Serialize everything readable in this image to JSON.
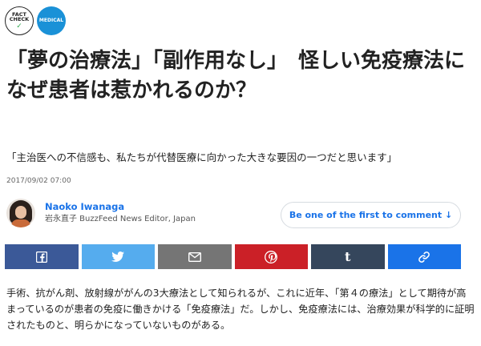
{
  "badges": {
    "fact_check_line1": "FACT",
    "fact_check_line2": "CHECK",
    "medical": "MEDICAL"
  },
  "article": {
    "title": "「夢の治療法」「副作用なし」　怪しい免疫療法になぜ患者は惹かれるのか？",
    "subtitle": "「主治医への不信感も、私たちが代替医療に向かった大きな要因の一つだと思います」",
    "date": "2017/09/02 07:00",
    "body": "手術、抗がん剤、放射線ががんの3大療法として知られるが、これに近年、「第４の療法」として期待が高まっているのが患者の免疫に働きかける「免疫療法」だ。しかし、免疫療法には、治療効果が科学的に証明されたものと、明らかになっていないものがある。"
  },
  "author": {
    "name": "Naoko Iwanaga",
    "role": "岩永直子 BuzzFeed News Editor, Japan"
  },
  "comment": {
    "label": "Be one of the first to comment ↓"
  },
  "share": [
    {
      "name": "facebook",
      "icon": "facebook-icon",
      "color": "#3b5998"
    },
    {
      "name": "twitter",
      "icon": "twitter-icon",
      "color": "#55acee"
    },
    {
      "name": "email",
      "icon": "mail-icon",
      "color": "#757575"
    },
    {
      "name": "pinterest",
      "icon": "pinterest-icon",
      "color": "#cb2027"
    },
    {
      "name": "tumblr",
      "icon": "tumblr-icon",
      "color": "#35465c"
    },
    {
      "name": "link",
      "icon": "link-icon",
      "color": "#1a73e8"
    }
  ]
}
